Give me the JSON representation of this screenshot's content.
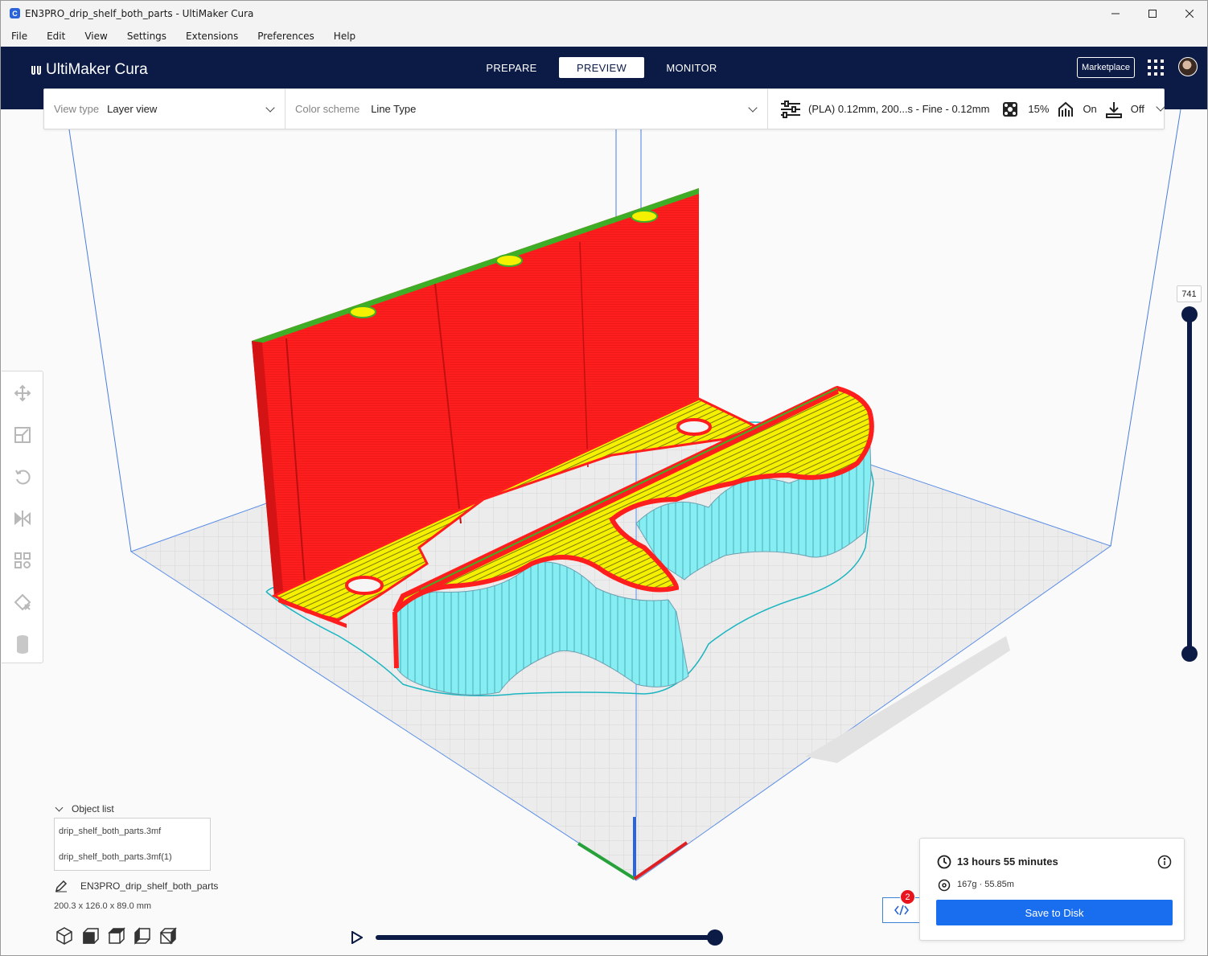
{
  "window": {
    "title": "EN3PRO_drip_shelf_both_parts - UltiMaker Cura",
    "app_icon_letter": "C"
  },
  "menu": [
    "File",
    "Edit",
    "View",
    "Settings",
    "Extensions",
    "Preferences",
    "Help"
  ],
  "header": {
    "logo_text": "UltiMaker Cura",
    "stages": [
      {
        "label": "PREPARE",
        "active": false
      },
      {
        "label": "PREVIEW",
        "active": true
      },
      {
        "label": "MONITOR",
        "active": false
      }
    ],
    "marketplace_label": "Marketplace"
  },
  "view_settings": {
    "view_type_label": "View type",
    "view_type_value": "Layer view",
    "color_scheme_label": "Color scheme",
    "color_scheme_value": "Line Type"
  },
  "print_settings": {
    "profile": "(PLA) 0.12mm, 200...s - Fine - 0.12mm",
    "infill": "15%",
    "support": "On",
    "adhesion": "Off"
  },
  "layer_slider": {
    "current_layer": "741"
  },
  "object_list": {
    "title": "Object list",
    "items": [
      "drip_shelf_both_parts.3mf",
      "drip_shelf_both_parts.3mf(1)"
    ],
    "job_name": "EN3PRO_drip_shelf_both_parts",
    "dimensions": "200.3 x 126.0 x 89.0 mm"
  },
  "print_info": {
    "time": "13 hours 55 minutes",
    "material": "167g · 55.85m",
    "save_label": "Save to Disk",
    "gcode_badge": "2"
  },
  "colors": {
    "header_bg": "#0c1b46",
    "wall": "#ff1e1e",
    "infill": "#f5ef00",
    "support": "#7fe8ec",
    "skin_edge": "#2a9d1a",
    "accent_button": "#196ef0"
  }
}
